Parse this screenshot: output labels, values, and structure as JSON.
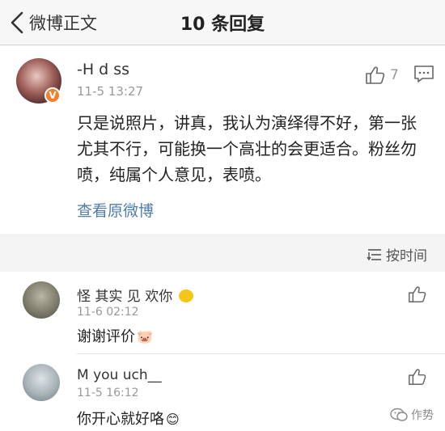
{
  "nav": {
    "back_label": "微博正文",
    "title": "10 条回复"
  },
  "original": {
    "username": "-H  d  ss",
    "badge": "V",
    "timestamp": "11-5 13:27",
    "like_count": "7",
    "content": "只是说照片，讲真，我认为演绎得不好，第一张尤其不行，可能换一个高壮的会更适合。粉丝勿喷，纯属个人意见，表喷。",
    "view_original": "查看原微博"
  },
  "sort": {
    "label": "按时间"
  },
  "replies": [
    {
      "username": "怪  其实  见  欢你",
      "timestamp": "11-6 02:12",
      "text": "谢谢评价",
      "emoji": "🐷"
    },
    {
      "username": "M  you  uch__",
      "timestamp": "11-5 16:12",
      "text": "你开心就好咯",
      "emoji": "😊"
    }
  ],
  "watermark": {
    "label": "作势"
  },
  "colors": {
    "link": "#4f7cae",
    "badge": "#f37e2a",
    "muted": "#999999"
  }
}
